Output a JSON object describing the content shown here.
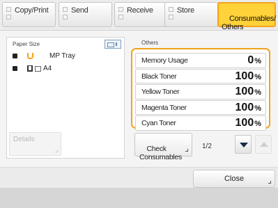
{
  "tabs": [
    {
      "label": "Copy/Print"
    },
    {
      "label": "Send"
    },
    {
      "label": "Receive"
    },
    {
      "label": "Store"
    },
    {
      "label": "Consumables/\nOthers"
    }
  ],
  "paper_panel": {
    "title": "Paper Size",
    "rows": [
      {
        "label": "MP Tray"
      },
      {
        "label": "A4"
      }
    ],
    "details_label": "Details"
  },
  "others": {
    "title": "Others",
    "rows": [
      {
        "label": "Memory Usage",
        "value": "0",
        "unit": "%"
      },
      {
        "label": "Black Toner",
        "value": "100",
        "unit": "%"
      },
      {
        "label": "Yellow Toner",
        "value": "100",
        "unit": "%"
      },
      {
        "label": "Magenta Toner",
        "value": "100",
        "unit": "%"
      },
      {
        "label": "Cyan Toner",
        "value": "100",
        "unit": "%"
      }
    ]
  },
  "check_consumables_label": "Check\nConsumables",
  "page_indicator": "1/2",
  "close_label": "Close",
  "colors": {
    "accent": "#ffd23a",
    "accent_border": "#f2a21b"
  }
}
